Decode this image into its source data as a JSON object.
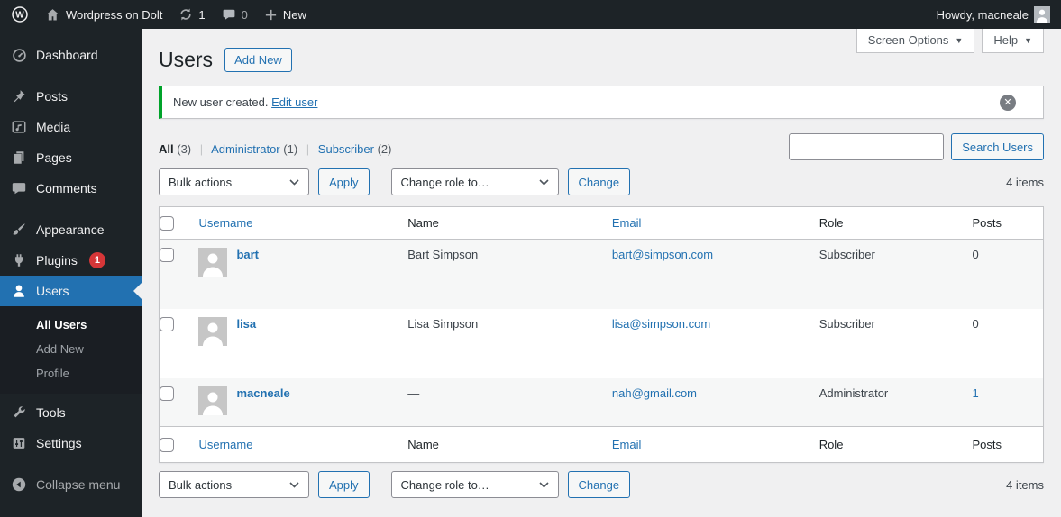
{
  "admin_bar": {
    "site_name": "Wordpress on Dolt",
    "update_count": "1",
    "comment_count": "0",
    "new_label": "New",
    "howdy_text": "Howdy, macneale"
  },
  "screen_meta": {
    "screen_options_label": "Screen Options",
    "help_label": "Help",
    "caret": "▼"
  },
  "sidebar": {
    "items": [
      {
        "label": "Dashboard"
      },
      {
        "label": "Posts"
      },
      {
        "label": "Media"
      },
      {
        "label": "Pages"
      },
      {
        "label": "Comments"
      },
      {
        "label": "Appearance"
      },
      {
        "label": "Plugins",
        "badge": "1"
      },
      {
        "label": "Users"
      },
      {
        "label": "Tools"
      },
      {
        "label": "Settings"
      }
    ],
    "users_submenu": [
      {
        "label": "All Users"
      },
      {
        "label": "Add New"
      },
      {
        "label": "Profile"
      }
    ],
    "collapse_label": "Collapse menu"
  },
  "page": {
    "title": "Users",
    "add_new_label": "Add New"
  },
  "notice": {
    "message": "New user created.",
    "link_label": "Edit user",
    "dismiss_glyph": "✕"
  },
  "views": {
    "all_label": "All",
    "all_count": "(3)",
    "administrator_label": "Administrator",
    "administrator_count": "(1)",
    "subscriber_label": "Subscriber",
    "subscriber_count": "(2)",
    "separator": "|"
  },
  "search": {
    "button_label": "Search Users",
    "value": ""
  },
  "bulk_bar": {
    "bulk_actions_label": "Bulk actions",
    "apply_label": "Apply",
    "change_role_label": "Change role to…",
    "change_label": "Change",
    "items_count": "4 items"
  },
  "table": {
    "headers": {
      "username": "Username",
      "name": "Name",
      "email": "Email",
      "role": "Role",
      "posts": "Posts"
    },
    "rows": [
      {
        "username": "bart",
        "name": "Bart Simpson",
        "email": "bart@simpson.com",
        "role": "Subscriber",
        "posts": "0"
      },
      {
        "username": "lisa",
        "name": "Lisa Simpson",
        "email": "lisa@simpson.com",
        "role": "Subscriber",
        "posts": "0"
      },
      {
        "username": "macneale",
        "name": "—",
        "email": "nah@gmail.com",
        "role": "Administrator",
        "posts": "1"
      }
    ]
  },
  "colors": {
    "accent_blue": "#2271b1",
    "admin_dark": "#1d2327",
    "notice_green": "#00a32a",
    "badge_red": "#d63638",
    "content_bg": "#f0f0f1"
  }
}
